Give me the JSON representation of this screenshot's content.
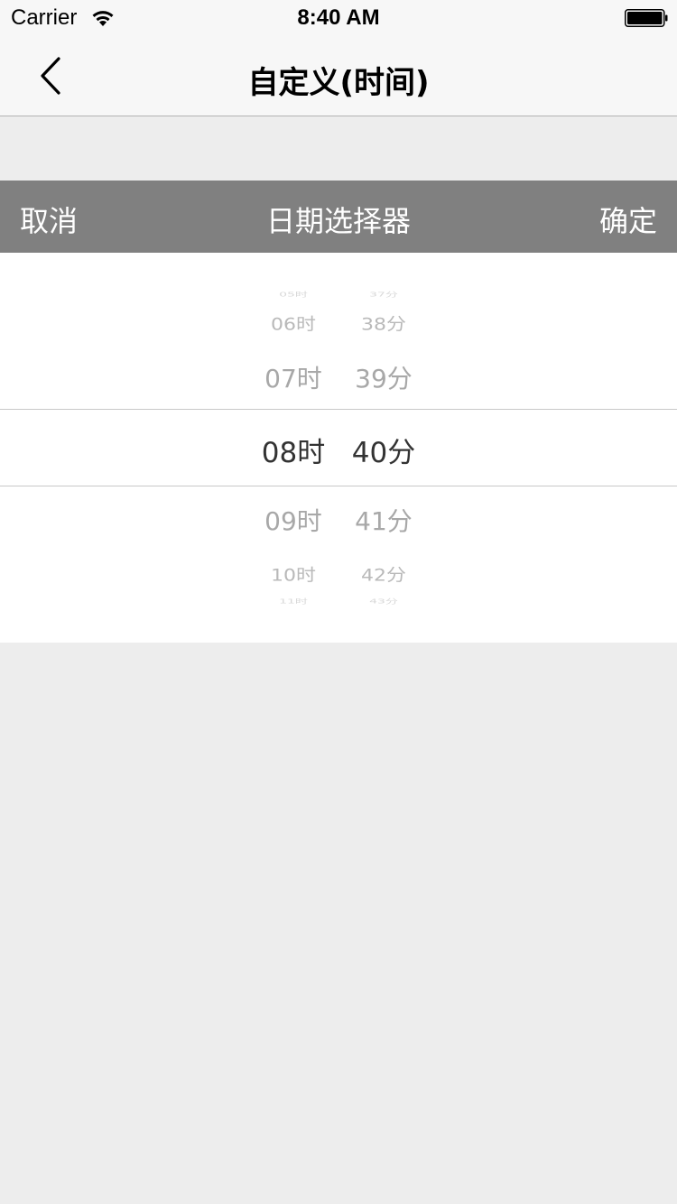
{
  "status_bar": {
    "carrier": "Carrier",
    "time": "8:40 AM",
    "wifi_icon": "wifi-icon",
    "battery_icon": "battery-icon"
  },
  "nav": {
    "title": "自定义(时间)",
    "back_icon": "chevron-left-icon"
  },
  "picker_toolbar": {
    "cancel_label": "取消",
    "title": "日期选择器",
    "confirm_label": "确定",
    "background_color": "#808080"
  },
  "picker": {
    "hours": [
      "05时",
      "06时",
      "07时",
      "08时",
      "09时",
      "10时",
      "11时"
    ],
    "minutes": [
      "37分",
      "38分",
      "39分",
      "40分",
      "41分",
      "42分",
      "43分"
    ],
    "selected_hour": "08时",
    "selected_minute": "40分"
  }
}
